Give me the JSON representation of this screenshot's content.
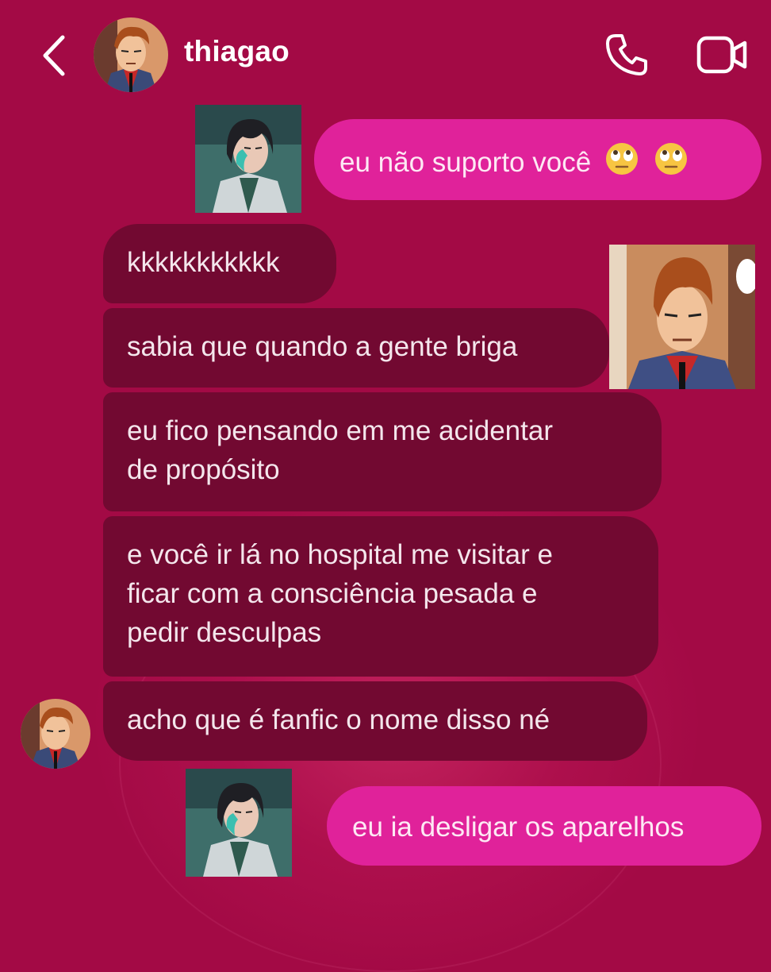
{
  "header": {
    "contact_name": "thiagao",
    "back_icon": "chevron-left-icon",
    "call_icon": "phone-icon",
    "video_icon": "video-camera-icon"
  },
  "messages": [
    {
      "direction": "sent",
      "text": "eu não suporto você",
      "emoji": "face-with-rolling-eyes",
      "emoji_count": 2
    },
    {
      "direction": "received",
      "text": "kkkkkkkkkkk"
    },
    {
      "direction": "received",
      "text": "sabia que quando a gente briga"
    },
    {
      "direction": "received",
      "lines": [
        "eu fico pensando em me acidentar",
        "de propósito"
      ]
    },
    {
      "direction": "received",
      "lines": [
        "e você ir lá no hospital me visitar e",
        "ficar com a consciência pesada e",
        "pedir desculpas"
      ]
    },
    {
      "direction": "received",
      "text": "acho que é fanfic o nome disso né"
    },
    {
      "direction": "sent",
      "text": "eu ia desligar os aparelhos"
    }
  ],
  "theme": {
    "background": "#a30a45",
    "sent_bubble": "#e0229a",
    "received_bubble": "#720931"
  }
}
